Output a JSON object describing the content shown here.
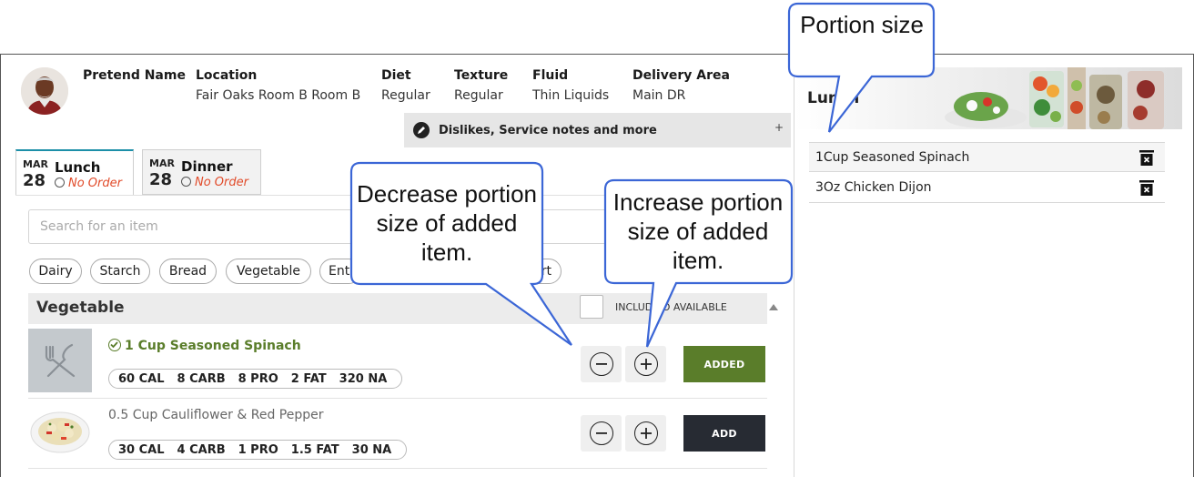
{
  "patient": {
    "name": "Pretend Name",
    "location_label": "Location",
    "location": "Fair Oaks Room B Room B",
    "diet_label": "Diet",
    "diet": "Regular",
    "texture_label": "Texture",
    "texture": "Regular",
    "fluid_label": "Fluid",
    "fluid": "Thin Liquids",
    "delivery_label": "Delivery Area",
    "delivery": "Main DR"
  },
  "dislikes": {
    "label": "Dislikes, Service notes and more",
    "expand": "+"
  },
  "tabs": [
    {
      "month": "MAR",
      "day": "28",
      "meal": "Lunch",
      "status": "No Order"
    },
    {
      "month": "MAR",
      "day": "28",
      "meal": "Dinner",
      "status": "No Order"
    }
  ],
  "search": {
    "placeholder": "Search for an item"
  },
  "categories": [
    "Dairy",
    "Starch",
    "Bread",
    "Vegetable",
    "Ent",
    "rt"
  ],
  "section": {
    "title": "Vegetable",
    "include_text": "INCLUD     SO AVAILABLE"
  },
  "items": [
    {
      "name": "1 Cup Seasoned Spinach",
      "cal": "60 CAL",
      "carb": "8 CARB",
      "pro": "8 PRO",
      "fat": "2 FAT",
      "na": "320 NA",
      "button": "ADDED",
      "added": true
    },
    {
      "name": "0.5 Cup Cauliflower & Red Pepper",
      "cal": "30 CAL",
      "carb": "4 CARB",
      "pro": "1 PRO",
      "fat": "1.5 FAT",
      "na": "30 NA",
      "button": "ADD",
      "added": false
    }
  ],
  "order_panel": {
    "title": "Lunch",
    "items": [
      "1Cup Seasoned Spinach",
      "3Oz Chicken Dijon"
    ]
  },
  "callouts": {
    "portion": "Portion size",
    "decrease": "Decrease portion size of added item.",
    "increase": "Increase portion size of added item."
  },
  "colors": {
    "added_green": "#5a7d2a",
    "add_dark": "#272b33",
    "tab_accent": "#1c8fa8",
    "no_order_red": "#e14b2a",
    "callout_border": "#3b66d6"
  }
}
